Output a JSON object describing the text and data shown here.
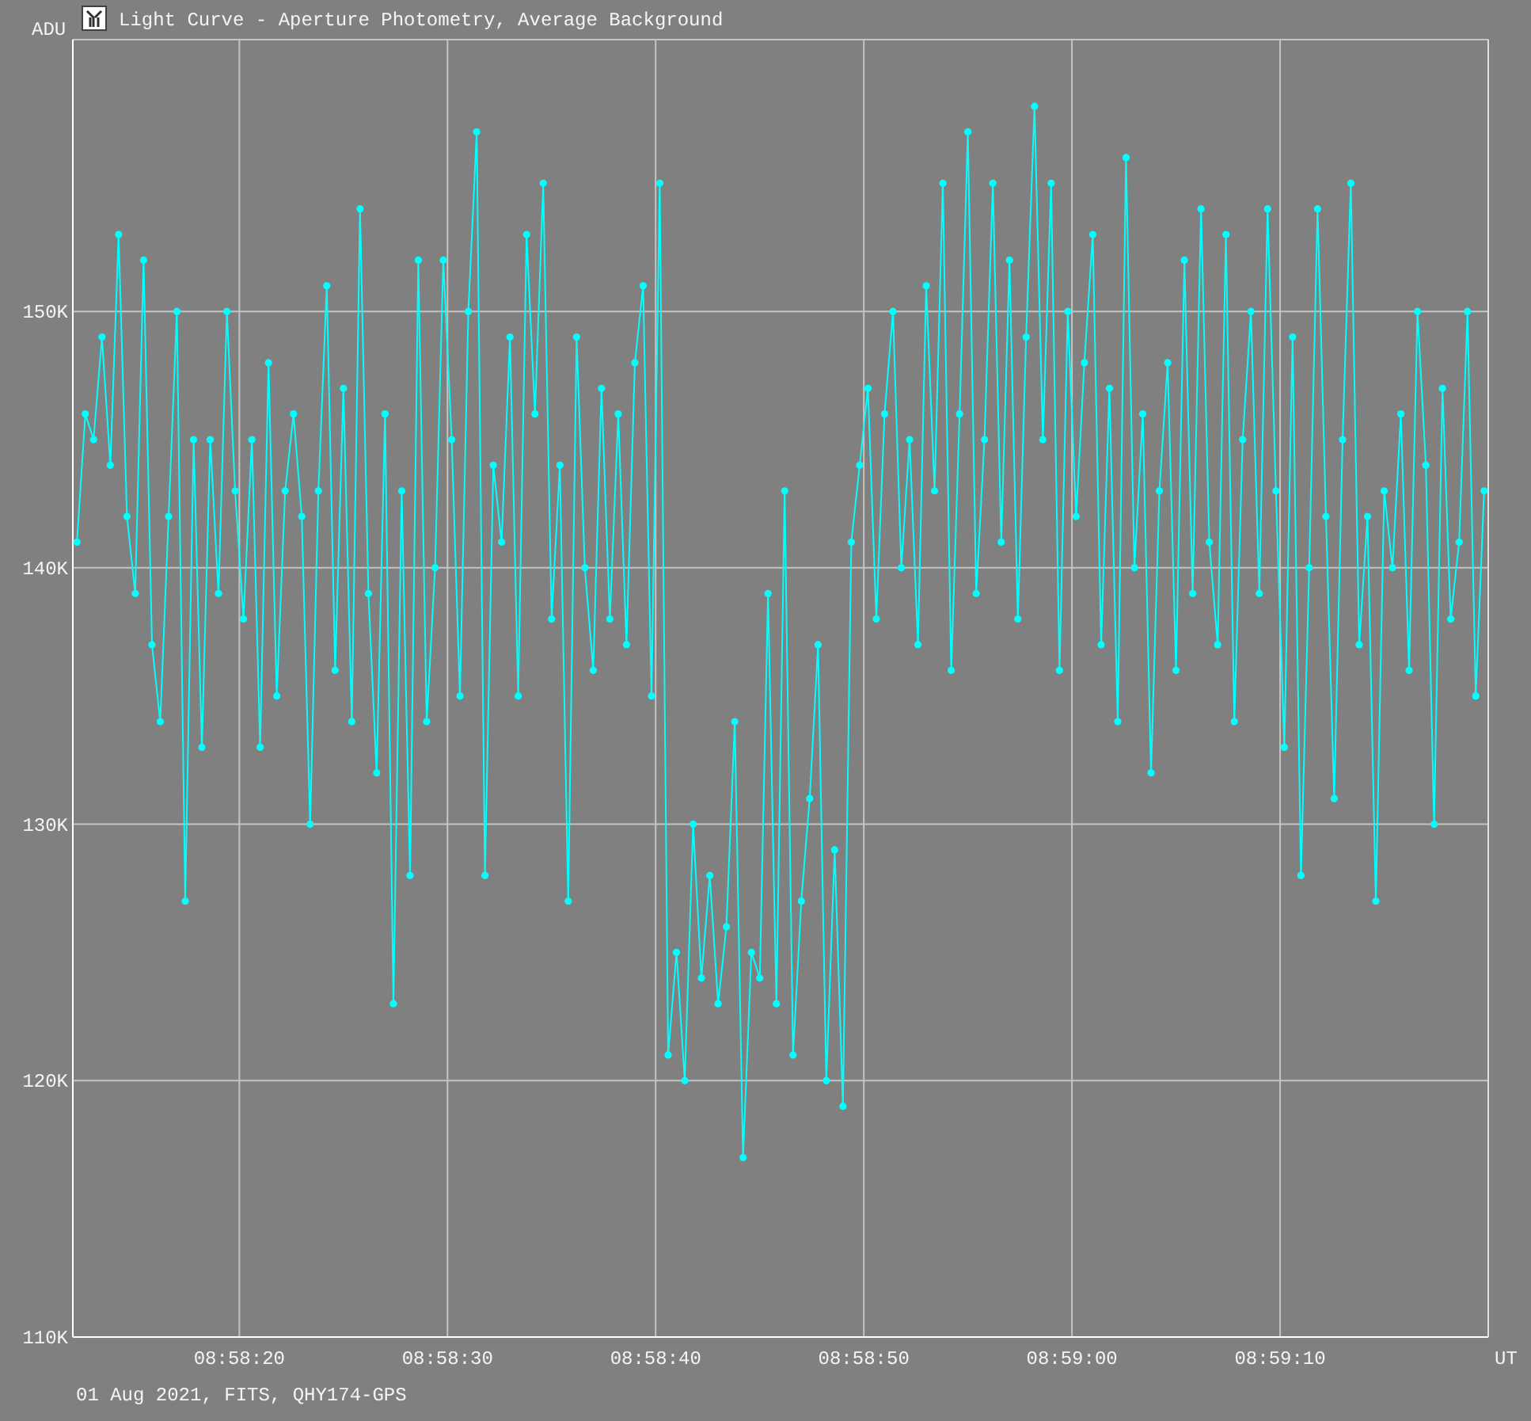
{
  "window": {
    "title": "Light Curve - Aperture Photometry, Average Background"
  },
  "chart_data": {
    "type": "line",
    "ylabel": "ADU",
    "xlabel": "UT",
    "x": [
      32292.2,
      32292.6,
      32293.0,
      32293.4,
      32293.8,
      32294.2,
      32294.6,
      32295.0,
      32295.4,
      32295.8,
      32296.2,
      32296.6,
      32297.0,
      32297.4,
      32297.8,
      32298.2,
      32298.6,
      32299.0,
      32299.4,
      32299.8,
      32300.2,
      32300.6,
      32301.0,
      32301.4,
      32301.8,
      32302.2,
      32302.6,
      32303.0,
      32303.4,
      32303.8,
      32304.2,
      32304.6,
      32305.0,
      32305.4,
      32305.8,
      32306.2,
      32306.6,
      32307.0,
      32307.4,
      32307.8,
      32308.2,
      32308.6,
      32309.0,
      32309.4,
      32309.8,
      32310.2,
      32310.6,
      32311.0,
      32311.4,
      32311.8,
      32312.2,
      32312.6,
      32313.0,
      32313.4,
      32313.8,
      32314.2,
      32314.6,
      32315.0,
      32315.4,
      32315.8,
      32316.2,
      32316.6,
      32317.0,
      32317.4,
      32317.8,
      32318.2,
      32318.6,
      32319.0,
      32319.4,
      32319.8,
      32320.2,
      32320.6,
      32321.0,
      32321.4,
      32321.8,
      32322.2,
      32322.6,
      32323.0,
      32323.4,
      32323.8,
      32324.2,
      32324.6,
      32325.0,
      32325.4,
      32325.8,
      32326.2,
      32326.6,
      32327.0,
      32327.4,
      32327.8,
      32328.2,
      32328.6,
      32329.0,
      32329.4,
      32329.8,
      32330.2,
      32330.6,
      32331.0,
      32331.4,
      32331.8,
      32332.2,
      32332.6,
      32333.0,
      32333.4,
      32333.8,
      32334.2,
      32334.6,
      32335.0,
      32335.4,
      32335.8,
      32336.2,
      32336.6,
      32337.0,
      32337.4,
      32337.8,
      32338.2,
      32338.6,
      32339.0,
      32339.4,
      32339.8,
      32340.2,
      32340.6,
      32341.0,
      32341.4,
      32341.8,
      32342.2,
      32342.6,
      32343.0,
      32343.4,
      32343.8,
      32344.2,
      32344.6,
      32345.0,
      32345.4,
      32345.8,
      32346.2,
      32346.6,
      32347.0,
      32347.4,
      32347.8,
      32348.2,
      32348.6,
      32349.0,
      32349.4,
      32349.8,
      32350.2,
      32350.6,
      32351.0,
      32351.4,
      32351.8,
      32352.2,
      32352.6,
      32353.0,
      32353.4,
      32353.8,
      32354.2,
      32354.6,
      32355.0,
      32355.4,
      32355.8,
      32356.2,
      32356.6,
      32357.0,
      32357.4,
      32357.8,
      32358.2,
      32358.6,
      32359.0,
      32359.4,
      32359.8
    ],
    "grid": true,
    "series": [
      {
        "color": "#00ffff",
        "marker": "circle",
        "values": [
          141,
          146,
          145,
          149,
          144,
          153,
          142,
          139,
          152,
          137,
          134,
          142,
          150,
          127,
          145,
          133,
          145,
          139,
          150,
          143,
          138,
          145,
          133,
          148,
          135,
          143,
          146,
          142,
          130,
          143,
          151,
          136,
          147,
          134,
          154,
          139,
          132,
          146,
          123,
          143,
          128,
          152,
          134,
          140,
          152,
          145,
          135,
          150,
          157,
          128,
          144,
          141,
          149,
          135,
          153,
          146,
          155,
          138,
          144,
          127,
          149,
          140,
          136,
          147,
          138,
          146,
          137,
          148,
          151,
          135,
          155,
          121,
          125,
          120,
          130,
          124,
          128,
          123,
          126,
          134,
          117,
          125,
          124,
          139,
          123,
          143,
          121,
          127,
          131,
          137,
          120,
          129,
          119,
          141,
          144,
          147,
          138,
          146,
          150,
          140,
          145,
          137,
          151,
          143,
          155,
          136,
          146,
          157,
          139,
          145,
          155,
          141,
          152,
          138,
          149,
          158,
          145,
          155,
          136,
          150,
          142,
          148,
          153,
          137,
          147,
          134,
          156,
          140,
          146,
          132,
          143,
          148,
          136,
          152,
          139,
          154,
          141,
          137,
          153,
          134,
          145,
          150,
          139,
          154,
          143,
          133,
          149,
          128,
          140,
          154,
          142,
          131,
          145,
          155,
          137,
          142,
          127,
          143,
          140,
          146,
          136,
          150,
          144,
          130,
          147,
          138,
          141,
          150,
          135,
          143
        ]
      }
    ],
    "xlim": [
      32292,
      32360
    ],
    "ylim": [
      110,
      160.6
    ],
    "xticks": [
      {
        "value": 32300,
        "label": "08:58:20"
      },
      {
        "value": 32310,
        "label": "08:58:30"
      },
      {
        "value": 32320,
        "label": "08:58:40"
      },
      {
        "value": 32330,
        "label": "08:58:50"
      },
      {
        "value": 32340,
        "label": "08:59:00"
      },
      {
        "value": 32350,
        "label": "08:59:10"
      }
    ],
    "yticks": [
      {
        "value": 110,
        "label": "110K"
      },
      {
        "value": 120,
        "label": "120K"
      },
      {
        "value": 130,
        "label": "130K"
      },
      {
        "value": 140,
        "label": "140K"
      },
      {
        "value": 150,
        "label": "150K"
      }
    ]
  },
  "footer": "01 Aug 2021, FITS, QHY174-GPS"
}
